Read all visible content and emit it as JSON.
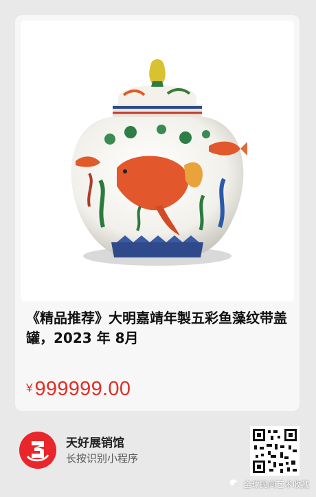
{
  "product": {
    "title": "《精品推荐》大明嘉靖年製五彩鱼藻纹带盖罐，2023 年 8月",
    "currency": "¥",
    "price": "999999.00"
  },
  "shop": {
    "name": "天好展销馆",
    "hint": "长按识别小程序"
  },
  "watermark": {
    "text": "全球民间艺术收藏",
    "icon": "wechat-icon"
  },
  "colors": {
    "price": "#e02e24",
    "logo": "#e8262b",
    "background": "#e9e9e9"
  }
}
